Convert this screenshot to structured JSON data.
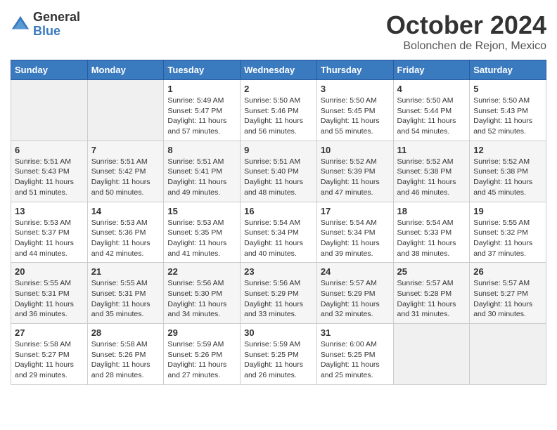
{
  "header": {
    "logo_general": "General",
    "logo_blue": "Blue",
    "month_title": "October 2024",
    "location": "Bolonchen de Rejon, Mexico"
  },
  "days_of_week": [
    "Sunday",
    "Monday",
    "Tuesday",
    "Wednesday",
    "Thursday",
    "Friday",
    "Saturday"
  ],
  "weeks": [
    [
      {
        "day": "",
        "empty": true
      },
      {
        "day": "",
        "empty": true
      },
      {
        "day": "1",
        "sunrise": "Sunrise: 5:49 AM",
        "sunset": "Sunset: 5:47 PM",
        "daylight": "Daylight: 11 hours and 57 minutes."
      },
      {
        "day": "2",
        "sunrise": "Sunrise: 5:50 AM",
        "sunset": "Sunset: 5:46 PM",
        "daylight": "Daylight: 11 hours and 56 minutes."
      },
      {
        "day": "3",
        "sunrise": "Sunrise: 5:50 AM",
        "sunset": "Sunset: 5:45 PM",
        "daylight": "Daylight: 11 hours and 55 minutes."
      },
      {
        "day": "4",
        "sunrise": "Sunrise: 5:50 AM",
        "sunset": "Sunset: 5:44 PM",
        "daylight": "Daylight: 11 hours and 54 minutes."
      },
      {
        "day": "5",
        "sunrise": "Sunrise: 5:50 AM",
        "sunset": "Sunset: 5:43 PM",
        "daylight": "Daylight: 11 hours and 52 minutes."
      }
    ],
    [
      {
        "day": "6",
        "sunrise": "Sunrise: 5:51 AM",
        "sunset": "Sunset: 5:43 PM",
        "daylight": "Daylight: 11 hours and 51 minutes."
      },
      {
        "day": "7",
        "sunrise": "Sunrise: 5:51 AM",
        "sunset": "Sunset: 5:42 PM",
        "daylight": "Daylight: 11 hours and 50 minutes."
      },
      {
        "day": "8",
        "sunrise": "Sunrise: 5:51 AM",
        "sunset": "Sunset: 5:41 PM",
        "daylight": "Daylight: 11 hours and 49 minutes."
      },
      {
        "day": "9",
        "sunrise": "Sunrise: 5:51 AM",
        "sunset": "Sunset: 5:40 PM",
        "daylight": "Daylight: 11 hours and 48 minutes."
      },
      {
        "day": "10",
        "sunrise": "Sunrise: 5:52 AM",
        "sunset": "Sunset: 5:39 PM",
        "daylight": "Daylight: 11 hours and 47 minutes."
      },
      {
        "day": "11",
        "sunrise": "Sunrise: 5:52 AM",
        "sunset": "Sunset: 5:38 PM",
        "daylight": "Daylight: 11 hours and 46 minutes."
      },
      {
        "day": "12",
        "sunrise": "Sunrise: 5:52 AM",
        "sunset": "Sunset: 5:38 PM",
        "daylight": "Daylight: 11 hours and 45 minutes."
      }
    ],
    [
      {
        "day": "13",
        "sunrise": "Sunrise: 5:53 AM",
        "sunset": "Sunset: 5:37 PM",
        "daylight": "Daylight: 11 hours and 44 minutes."
      },
      {
        "day": "14",
        "sunrise": "Sunrise: 5:53 AM",
        "sunset": "Sunset: 5:36 PM",
        "daylight": "Daylight: 11 hours and 42 minutes."
      },
      {
        "day": "15",
        "sunrise": "Sunrise: 5:53 AM",
        "sunset": "Sunset: 5:35 PM",
        "daylight": "Daylight: 11 hours and 41 minutes."
      },
      {
        "day": "16",
        "sunrise": "Sunrise: 5:54 AM",
        "sunset": "Sunset: 5:34 PM",
        "daylight": "Daylight: 11 hours and 40 minutes."
      },
      {
        "day": "17",
        "sunrise": "Sunrise: 5:54 AM",
        "sunset": "Sunset: 5:34 PM",
        "daylight": "Daylight: 11 hours and 39 minutes."
      },
      {
        "day": "18",
        "sunrise": "Sunrise: 5:54 AM",
        "sunset": "Sunset: 5:33 PM",
        "daylight": "Daylight: 11 hours and 38 minutes."
      },
      {
        "day": "19",
        "sunrise": "Sunrise: 5:55 AM",
        "sunset": "Sunset: 5:32 PM",
        "daylight": "Daylight: 11 hours and 37 minutes."
      }
    ],
    [
      {
        "day": "20",
        "sunrise": "Sunrise: 5:55 AM",
        "sunset": "Sunset: 5:31 PM",
        "daylight": "Daylight: 11 hours and 36 minutes."
      },
      {
        "day": "21",
        "sunrise": "Sunrise: 5:55 AM",
        "sunset": "Sunset: 5:31 PM",
        "daylight": "Daylight: 11 hours and 35 minutes."
      },
      {
        "day": "22",
        "sunrise": "Sunrise: 5:56 AM",
        "sunset": "Sunset: 5:30 PM",
        "daylight": "Daylight: 11 hours and 34 minutes."
      },
      {
        "day": "23",
        "sunrise": "Sunrise: 5:56 AM",
        "sunset": "Sunset: 5:29 PM",
        "daylight": "Daylight: 11 hours and 33 minutes."
      },
      {
        "day": "24",
        "sunrise": "Sunrise: 5:57 AM",
        "sunset": "Sunset: 5:29 PM",
        "daylight": "Daylight: 11 hours and 32 minutes."
      },
      {
        "day": "25",
        "sunrise": "Sunrise: 5:57 AM",
        "sunset": "Sunset: 5:28 PM",
        "daylight": "Daylight: 11 hours and 31 minutes."
      },
      {
        "day": "26",
        "sunrise": "Sunrise: 5:57 AM",
        "sunset": "Sunset: 5:27 PM",
        "daylight": "Daylight: 11 hours and 30 minutes."
      }
    ],
    [
      {
        "day": "27",
        "sunrise": "Sunrise: 5:58 AM",
        "sunset": "Sunset: 5:27 PM",
        "daylight": "Daylight: 11 hours and 29 minutes."
      },
      {
        "day": "28",
        "sunrise": "Sunrise: 5:58 AM",
        "sunset": "Sunset: 5:26 PM",
        "daylight": "Daylight: 11 hours and 28 minutes."
      },
      {
        "day": "29",
        "sunrise": "Sunrise: 5:59 AM",
        "sunset": "Sunset: 5:26 PM",
        "daylight": "Daylight: 11 hours and 27 minutes."
      },
      {
        "day": "30",
        "sunrise": "Sunrise: 5:59 AM",
        "sunset": "Sunset: 5:25 PM",
        "daylight": "Daylight: 11 hours and 26 minutes."
      },
      {
        "day": "31",
        "sunrise": "Sunrise: 6:00 AM",
        "sunset": "Sunset: 5:25 PM",
        "daylight": "Daylight: 11 hours and 25 minutes."
      },
      {
        "day": "",
        "empty": true
      },
      {
        "day": "",
        "empty": true
      }
    ]
  ]
}
